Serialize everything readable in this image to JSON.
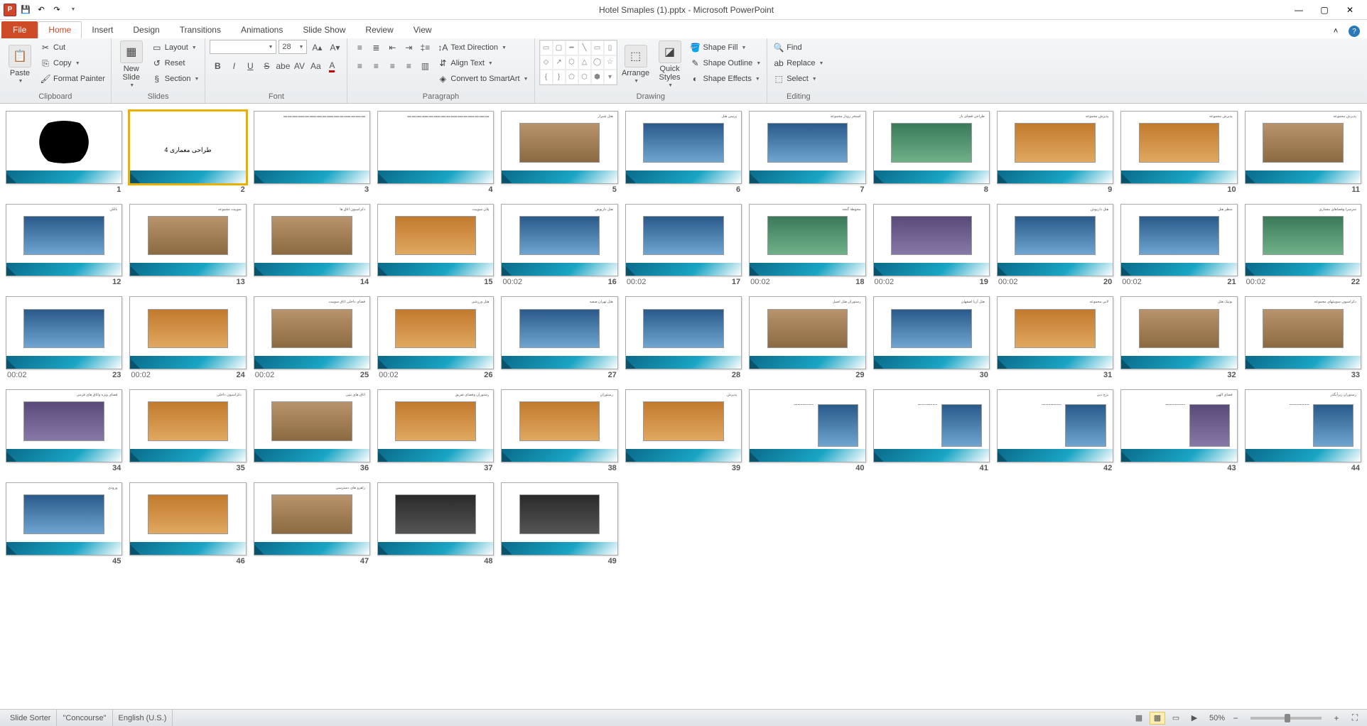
{
  "titlebar": {
    "app_letter": "P",
    "title": "Hotel Smaples (1).pptx - Microsoft PowerPoint"
  },
  "tabs": {
    "file": "File",
    "items": [
      "Home",
      "Insert",
      "Design",
      "Transitions",
      "Animations",
      "Slide Show",
      "Review",
      "View"
    ],
    "active": "Home"
  },
  "ribbon": {
    "clipboard": {
      "label": "Clipboard",
      "paste": "Paste",
      "cut": "Cut",
      "copy": "Copy",
      "format_painter": "Format Painter"
    },
    "slides": {
      "label": "Slides",
      "new_slide": "New\nSlide",
      "layout": "Layout",
      "reset": "Reset",
      "section": "Section"
    },
    "font": {
      "label": "Font",
      "family_value": "",
      "size_value": "28"
    },
    "paragraph": {
      "label": "Paragraph",
      "text_direction": "Text Direction",
      "align_text": "Align Text",
      "convert_smartart": "Convert to SmartArt"
    },
    "drawing": {
      "label": "Drawing",
      "arrange": "Arrange",
      "quick_styles": "Quick\nStyles",
      "shape_fill": "Shape Fill",
      "shape_outline": "Shape Outline",
      "shape_effects": "Shape Effects"
    },
    "editing": {
      "label": "Editing",
      "find": "Find",
      "replace": "Replace",
      "select": "Select"
    }
  },
  "slides": [
    {
      "n": 1,
      "type": "calli",
      "title": ""
    },
    {
      "n": 2,
      "type": "title",
      "title": "طراحی معماری 4",
      "selected": true
    },
    {
      "n": 3,
      "type": "text",
      "title": ""
    },
    {
      "n": 4,
      "type": "text",
      "title": ""
    },
    {
      "n": 5,
      "type": "photo",
      "cls": "photo1",
      "title": "هتل شیراز"
    },
    {
      "n": 6,
      "type": "photo",
      "cls": "photo2",
      "title": "پرسی هتل"
    },
    {
      "n": 7,
      "type": "photo",
      "cls": "photo2",
      "title": "استخر روباز مجموعه"
    },
    {
      "n": 8,
      "type": "photo",
      "cls": "photo4",
      "title": "طراحی فضای باز"
    },
    {
      "n": 9,
      "type": "photo",
      "cls": "photo3",
      "title": "پذیرش مجموعه"
    },
    {
      "n": 10,
      "type": "photo",
      "cls": "photo3",
      "title": "پذیرش مجموعه"
    },
    {
      "n": 11,
      "type": "photo",
      "cls": "photo1",
      "title": "پذیرش مجموعه"
    },
    {
      "n": 12,
      "type": "photo",
      "cls": "photo2",
      "title": "بالکن"
    },
    {
      "n": 13,
      "type": "photo",
      "cls": "photo1",
      "title": "سوییت مجموعه"
    },
    {
      "n": 14,
      "type": "photo",
      "cls": "photo1",
      "title": "دکراسیون اتاق ها"
    },
    {
      "n": 15,
      "type": "photo",
      "cls": "photo3",
      "title": "پلان سوییت"
    },
    {
      "n": 16,
      "type": "photo",
      "cls": "photo2",
      "title": "هتل داریوش",
      "time": "00:02"
    },
    {
      "n": 17,
      "type": "photo",
      "cls": "photo2",
      "title": "",
      "time": "00:02"
    },
    {
      "n": 18,
      "type": "photo",
      "cls": "photo4",
      "title": "محوطه گنجه",
      "time": "00:02"
    },
    {
      "n": 19,
      "type": "photo",
      "cls": "photo5",
      "title": "",
      "time": "00:02"
    },
    {
      "n": 20,
      "type": "photo",
      "cls": "photo2",
      "title": "هتل داریوش",
      "time": "00:02"
    },
    {
      "n": 21,
      "type": "photo",
      "cls": "photo2",
      "title": "منظر هتل",
      "time": "00:02"
    },
    {
      "n": 22,
      "type": "photo",
      "cls": "photo4",
      "title": "سرسرا وفضاهای معماری",
      "time": "00:02"
    },
    {
      "n": 23,
      "type": "photo",
      "cls": "photo2",
      "title": "",
      "time": "00:02"
    },
    {
      "n": 24,
      "type": "photo",
      "cls": "photo3",
      "title": "",
      "time": "00:02"
    },
    {
      "n": 25,
      "type": "photo",
      "cls": "photo1",
      "title": "فضای داخلی اتاق سوییت",
      "time": "00:02"
    },
    {
      "n": 26,
      "type": "photo",
      "cls": "photo3",
      "title": "هتل ورزشی",
      "time": "00:02"
    },
    {
      "n": 27,
      "type": "photo",
      "cls": "photo2",
      "title": "هتل تهران صفیه"
    },
    {
      "n": 28,
      "type": "photo",
      "cls": "photo2",
      "title": ""
    },
    {
      "n": 29,
      "type": "photo",
      "cls": "photo1",
      "title": "رستوران هتل اصیل"
    },
    {
      "n": 30,
      "type": "photo",
      "cls": "photo2",
      "title": "هتل آریا اصفهان"
    },
    {
      "n": 31,
      "type": "photo",
      "cls": "photo3",
      "title": "لابی مجموعه"
    },
    {
      "n": 32,
      "type": "photo",
      "cls": "photo1",
      "title": "بوتیک هتل"
    },
    {
      "n": 33,
      "type": "photo",
      "cls": "photo1",
      "title": "دکراسیون سوییتهای مجموعه"
    },
    {
      "n": 34,
      "type": "photo",
      "cls": "photo5",
      "title": "فضای ویژه واتاق های فرمی"
    },
    {
      "n": 35,
      "type": "photo",
      "cls": "photo3",
      "title": "دکراسیون داخلی"
    },
    {
      "n": 36,
      "type": "photo",
      "cls": "photo1",
      "title": "اتاق های تیپی"
    },
    {
      "n": 37,
      "type": "photo",
      "cls": "photo3",
      "title": "رستوران وفضای تفریق"
    },
    {
      "n": 38,
      "type": "photo",
      "cls": "photo3",
      "title": "رستوران"
    },
    {
      "n": 39,
      "type": "photo",
      "cls": "photo3",
      "title": "پذیرش"
    },
    {
      "n": 40,
      "type": "textphoto",
      "cls": "photo2",
      "title": ""
    },
    {
      "n": 41,
      "type": "textphoto",
      "cls": "photo2",
      "title": ""
    },
    {
      "n": 42,
      "type": "textphoto",
      "cls": "photo2",
      "title": "برج دبی"
    },
    {
      "n": 43,
      "type": "textphoto",
      "cls": "photo5",
      "title": "فضای الهی"
    },
    {
      "n": 44,
      "type": "textphoto",
      "cls": "photo2",
      "title": "رستوران زیرآبگذر"
    },
    {
      "n": 45,
      "type": "photo",
      "cls": "photo2",
      "title": "ورودی"
    },
    {
      "n": 46,
      "type": "photo",
      "cls": "photo3",
      "title": ""
    },
    {
      "n": 47,
      "type": "photo",
      "cls": "photo1",
      "title": "راهرو های دسترسی"
    },
    {
      "n": 48,
      "type": "photo",
      "cls": "dark",
      "title": ""
    },
    {
      "n": 49,
      "type": "photo",
      "cls": "dark",
      "title": ""
    }
  ],
  "statusbar": {
    "view": "Slide Sorter",
    "theme": "\"Concourse\"",
    "lang": "English (U.S.)",
    "zoom": "50%"
  }
}
